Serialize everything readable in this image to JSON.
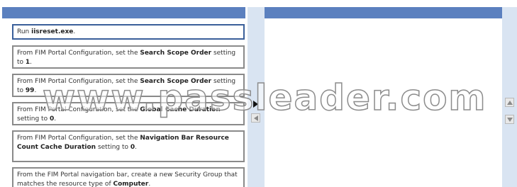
{
  "items": [
    {
      "parts": [
        {
          "t": "Run "
        },
        {
          "t": "iisreset.exe",
          "b": true
        },
        {
          "t": "."
        }
      ]
    },
    {
      "parts": [
        {
          "t": "From FIM Portal Configuration, set the "
        },
        {
          "t": "Search Scope Order",
          "b": true
        },
        {
          "t": " setting to "
        },
        {
          "t": "1",
          "b": true
        },
        {
          "t": "."
        }
      ]
    },
    {
      "parts": [
        {
          "t": "From FIM Portal Configuration, set the "
        },
        {
          "t": "Search Scope Order",
          "b": true
        },
        {
          "t": " setting to "
        },
        {
          "t": "99",
          "b": true
        },
        {
          "t": "."
        }
      ]
    },
    {
      "parts": [
        {
          "t": "From FIM Portal Configuration, set the "
        },
        {
          "t": "Global Cache Duration",
          "b": true
        },
        {
          "t": " setting to "
        },
        {
          "t": "0",
          "b": true
        },
        {
          "t": "."
        }
      ]
    },
    {
      "parts": [
        {
          "t": "From FIM Portal Configuration, set the "
        },
        {
          "t": "Navigation Bar Resource Count Cache Duration",
          "b": true
        },
        {
          "t": " setting to "
        },
        {
          "t": "0",
          "b": true
        },
        {
          "t": "."
        }
      ]
    },
    {
      "parts": [
        {
          "t": "From the FIM Portal navigation bar, create a new Security Group that matches the resource type of "
        },
        {
          "t": "Computer",
          "b": true
        },
        {
          "t": "."
        }
      ]
    }
  ],
  "watermark": "www.passleader.com",
  "colors": {
    "header": "#5b80bf",
    "strip": "#d9e4f2",
    "item_border": "#8a8a8a",
    "selected_border": "#3a5f9a"
  },
  "icons": {
    "move_left": "arrow-left-icon",
    "move_up": "arrow-up-icon",
    "move_down": "arrow-down-icon"
  }
}
